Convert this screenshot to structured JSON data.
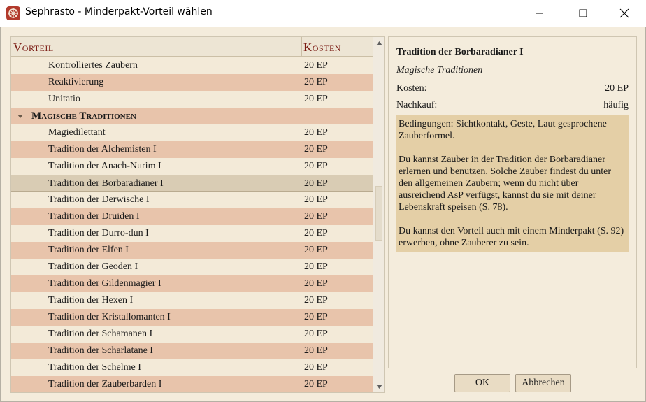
{
  "window": {
    "title": "Sephrasto - Minderpakt-Vorteil wählen"
  },
  "tree": {
    "header": {
      "name": "Vorteil",
      "cost": "Kosten"
    },
    "rows": [
      {
        "type": "item",
        "name": "Kontrolliertes Zaubern",
        "cost": "20 EP"
      },
      {
        "type": "item",
        "name": "Reaktivierung",
        "cost": "20 EP"
      },
      {
        "type": "item",
        "name": "Unitatio",
        "cost": "20 EP"
      },
      {
        "type": "category",
        "name": "Magische Traditionen"
      },
      {
        "type": "item",
        "name": "Magiedilettant",
        "cost": "20 EP"
      },
      {
        "type": "item",
        "name": "Tradition der Alchemisten I",
        "cost": "20 EP"
      },
      {
        "type": "item",
        "name": "Tradition der Anach-Nurim I",
        "cost": "20 EP"
      },
      {
        "type": "item",
        "name": "Tradition der Borbaradianer I",
        "cost": "20 EP",
        "selected": true
      },
      {
        "type": "item",
        "name": "Tradition der Derwische I",
        "cost": "20 EP"
      },
      {
        "type": "item",
        "name": "Tradition der Druiden I",
        "cost": "20 EP"
      },
      {
        "type": "item",
        "name": "Tradition der Durro-dun I",
        "cost": "20 EP"
      },
      {
        "type": "item",
        "name": "Tradition der Elfen I",
        "cost": "20 EP"
      },
      {
        "type": "item",
        "name": "Tradition der Geoden I",
        "cost": "20 EP"
      },
      {
        "type": "item",
        "name": "Tradition der Gildenmagier I",
        "cost": "20 EP"
      },
      {
        "type": "item",
        "name": "Tradition der Hexen I",
        "cost": "20 EP"
      },
      {
        "type": "item",
        "name": "Tradition der Kristallomanten I",
        "cost": "20 EP"
      },
      {
        "type": "item",
        "name": "Tradition der Schamanen I",
        "cost": "20 EP"
      },
      {
        "type": "item",
        "name": "Tradition der Scharlatane I",
        "cost": "20 EP"
      },
      {
        "type": "item",
        "name": "Tradition der Schelme I",
        "cost": "20 EP"
      },
      {
        "type": "item",
        "name": "Tradition der Zauberbarden I",
        "cost": "20 EP"
      }
    ]
  },
  "detail": {
    "title": "Tradition der Borbaradianer I",
    "category": "Magische Traditionen",
    "cost_label": "Kosten:",
    "cost_value": "20 EP",
    "nachkauf_label": "Nachkauf:",
    "nachkauf_value": "häufig",
    "paragraphs": [
      "Bedingungen: Sichtkontakt, Geste, Laut gesprochene Zauberformel.",
      "Du kannst Zauber in der Tradition der Borbaradianer erlernen und benutzen. Solche Zauber findest du unter den allgemeinen Zaubern; wenn du nicht über ausreichend AsP verfügst, kannst du sie mit deiner Lebenskraft speisen (S. 78).",
      "Du kannst den Vorteil auch mit einem Minderpakt (S. 92) erwerben, ohne Zauberer zu sein."
    ]
  },
  "buttons": {
    "ok": "OK",
    "cancel": "Abbrechen"
  },
  "colors": {
    "header_text": "#7a1a12",
    "row_light": "#f3ead8",
    "row_dark": "#e8c4ab",
    "row_selected": "#d9ccb4",
    "description_box": "#e4cfa6",
    "window_bg": "#f4ecdc"
  },
  "icons": {
    "app": "sephrasto-logo-icon",
    "minimize": "minimize-icon",
    "maximize": "maximize-icon",
    "close": "close-icon",
    "expand": "chevron-down-icon",
    "scroll_up": "scroll-up-icon",
    "scroll_down": "scroll-down-icon"
  }
}
